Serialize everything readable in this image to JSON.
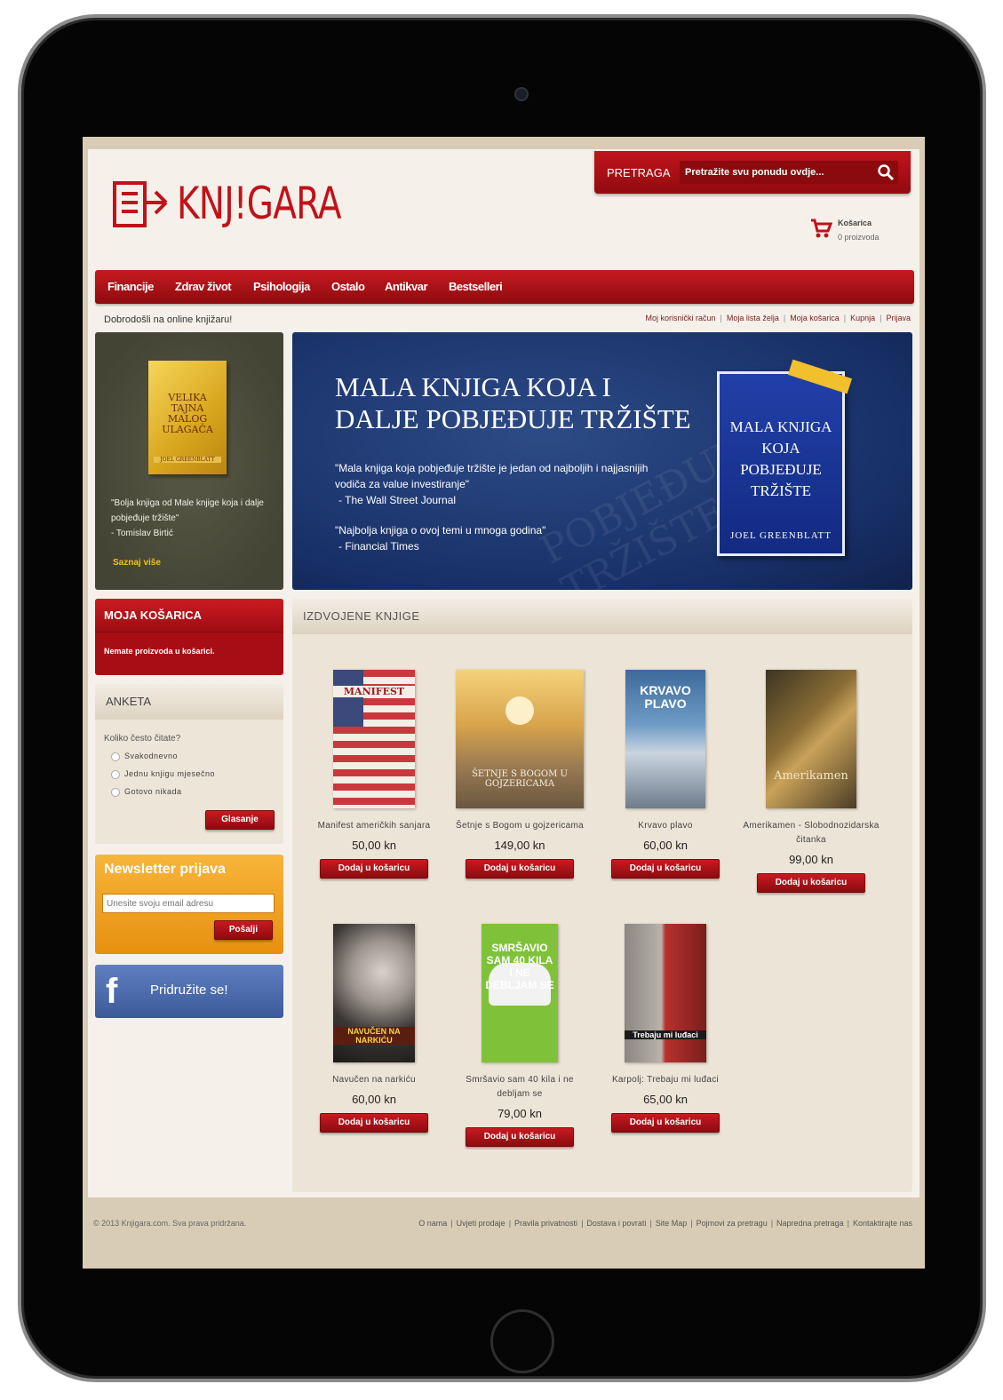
{
  "site": {
    "logo_text": "KNJ!GARA",
    "search_label": "PRETRAGA",
    "search_placeholder": "Pretražite svu ponudu ovdje...",
    "cart_title": "Košarica",
    "cart_sub": "0 proizvoda"
  },
  "nav": [
    "Financije",
    "Zdrav život",
    "Psihologija",
    "Ostalo",
    "Antikvar",
    "Bestselleri"
  ],
  "welcome": "Dobrodošli na online knjižaru!",
  "top_links": [
    "Moj korisnički račun",
    "Moja lista želja",
    "Moja košarica",
    "Kupnja",
    "Prijava"
  ],
  "promo": {
    "book_title": "VELIKA TAJNA MALOG ULAGAČA",
    "book_author": "JOEL GREENBLATT",
    "quote": "\"Bolja knjiga od Male knjige koja i dalje pobjeđuje tržište\"",
    "quote_author": "- Tomislav Birtić",
    "link": "Saznaj više"
  },
  "banner": {
    "title_line1": "MALA KNJIGA KOJA I",
    "title_line2": "DALJE POBJEĐUJE TRŽIŠTE",
    "quote1": "\"Mala knjiga koja pobjeđuje tržište je jedan od najboljih i najjasnijih vodiča za value investiranje\"",
    "quote1_source": "- The Wall Street Journal",
    "quote2": "\"Najbolja knjiga o ovoj temi u mnoga godina\"",
    "quote2_source": "- Financial Times",
    "book_title": "MALA KNJIGA KOJA POBJEĐUJE TRŽIŠTE",
    "book_author": "JOEL GREENBLATT"
  },
  "cart_box": {
    "title": "MOJA KOŠARICA",
    "empty": "Nemate proizvoda u košarici."
  },
  "poll": {
    "title": "ANKETA",
    "question": "Koliko često čitate?",
    "options": [
      "Svakodnevno",
      "Jednu knjigu mjesečno",
      "Gotovo nikada"
    ],
    "button": "Glasanje"
  },
  "newsletter": {
    "title": "Newsletter prijava",
    "placeholder": "Unesite svoju email adresu",
    "button": "Pošalji"
  },
  "facebook": {
    "text": "Pridružite se!"
  },
  "featured": {
    "title": "IZDVOJENE KNJIGE",
    "products": [
      {
        "name": "Manifest američkih sanjara",
        "price": "50,00 kn",
        "button": "Dodaj u košaricu",
        "cover_text": "MANIFEST"
      },
      {
        "name": "Šetnje s Bogom u gojzericama",
        "price": "149,00 kn",
        "button": "Dodaj u košaricu",
        "cover_text": "ŠETNJE S BOGOM U GOJZERICAMA"
      },
      {
        "name": "Krvavo plavo",
        "price": "60,00 kn",
        "button": "Dodaj u košaricu",
        "cover_text": "KRVAVO PLAVO"
      },
      {
        "name": "Amerikamen - Slobodnozidarska čitanka",
        "price": "99,00 kn",
        "button": "Dodaj u košaricu",
        "cover_text": "Amerikamen"
      },
      {
        "name": "Navučen na narkiću",
        "price": "60,00 kn",
        "button": "Dodaj u košaricu",
        "cover_text": "NAVUČEN NA NARKIĆU"
      },
      {
        "name": "Smršavio sam 40 kila i ne debljam se",
        "price": "79,00 kn",
        "button": "Dodaj u košaricu",
        "cover_text": "SMRŠAVIO SAM 40 KILA I NE DEBLJAM SE"
      },
      {
        "name": "Karpolj: Trebaju mi luđaci",
        "price": "65,00 kn",
        "button": "Dodaj u košaricu",
        "cover_text": "Trebaju mi luđaci"
      }
    ]
  },
  "footer": {
    "copyright": "© 2013 Knjigara.com. Sva prava pridržana.",
    "links": [
      "O nama",
      "Uvjeti prodaje",
      "Pravila privatnosti",
      "Dostava i povrati",
      "Site Map",
      "Pojmovi za pretragu",
      "Napredna pretraga",
      "Kontaktirajte nas"
    ]
  },
  "colors": {
    "brand_red": "#c1121a",
    "nav_dark": "#8d0b0f",
    "banner_blue": "#183068",
    "newsletter_orange": "#f0a020",
    "facebook_blue": "#3c5a9a"
  }
}
